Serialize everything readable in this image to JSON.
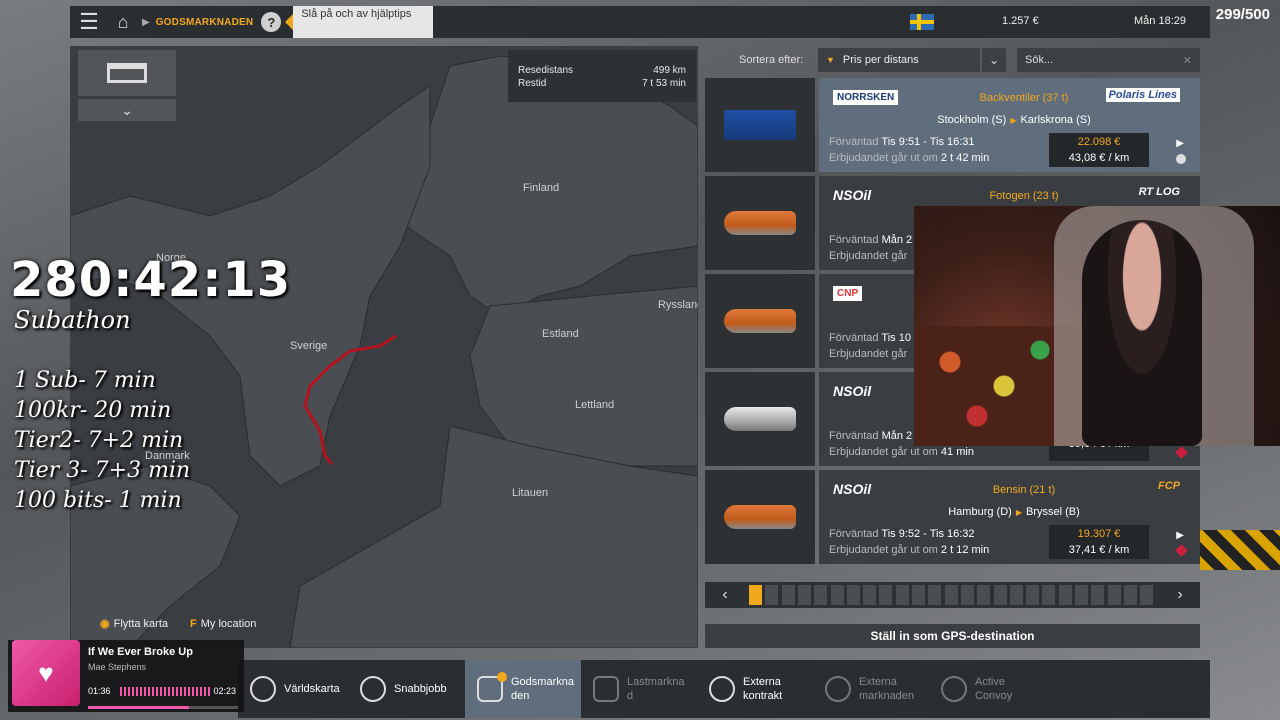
{
  "topbar": {
    "breadcrumb": "GODSMARKNADEN",
    "help": "?",
    "tip": "Slå på och av hjälptips",
    "money": "1.257 €",
    "clock": "Mån 18:29"
  },
  "stream": {
    "counter": "299/500",
    "timer": "280:42:13",
    "subathon": "Subathon",
    "rates": [
      "1 Sub- 7 min",
      "100kr- 20 min",
      "Tier2- 7+2 min",
      "Tier 3- 7+3 min",
      "100 bits- 1 min"
    ]
  },
  "map": {
    "route": {
      "distance_label": "Resedistans",
      "distance": "499 km",
      "time_label": "Restid",
      "time": "7 t 53 min"
    },
    "countries": {
      "finland": "Finland",
      "norge": "Norge",
      "sverige": "Sverige",
      "estland": "Estland",
      "ryssland": "Ryssland",
      "lettland": "Lettland",
      "danmark": "Danmark",
      "litauen": "Litauen"
    },
    "hints": {
      "move_key": "",
      "move_label": "Flytta karta",
      "loc_key": "F",
      "loc_label": "My location"
    }
  },
  "sort": {
    "label": "Sortera efter:",
    "value": "Pris per distans"
  },
  "search": {
    "placeholder": "Sök..."
  },
  "cargo": [
    {
      "sender": "NORRSKEN",
      "cargo": "Backventiler (37 t)",
      "receiver": "Polaris Lines",
      "from": "Stockholm (S)",
      "to": "Karlskrona (S)",
      "expected_label": "Förväntad",
      "expected": "Tis 9:51 - Tis 16:31",
      "expires_label": "Erbjudandet går ut om",
      "expires": "2 t 42 min",
      "price": "22.098 €",
      "per_km": "43,08 € / km"
    },
    {
      "sender": "NSOil",
      "cargo": "Fotogen (23 t)",
      "receiver": "RT LOG",
      "expected_label": "Förväntad",
      "expected": "Mån 2",
      "expires_label": "Erbjudandet går"
    },
    {
      "sender": "CNP",
      "expected_label": "Förväntad",
      "expected": "Tis 10",
      "expires_label": "Erbjudandet går"
    },
    {
      "sender": "NSOil",
      "expected_label": "Förväntad",
      "expected": "Mån 2",
      "expires_label": "Erbjudandet går ut om",
      "expires": "41 min",
      "per_km": "39,04 € / km"
    },
    {
      "sender": "NSOil",
      "cargo": "Bensin (21 t)",
      "receiver": "FCP",
      "from": "Hamburg (D)",
      "to": "Bryssel (B)",
      "expected_label": "Förväntad",
      "expected": "Tis 9:52 - Tis 16:32",
      "expires_label": "Erbjudandet går ut om",
      "expires": "2 t 12 min",
      "price": "19.307 €",
      "per_km": "37,41 € / km"
    }
  ],
  "gps_button": "Ställ in som GPS-destination",
  "nav": {
    "varldskarta": "Världskarta",
    "snabbjobb": "Snabbjobb",
    "godsmarknaden": "Godsmarkna den",
    "lastmarknad": "Lastmarkna d",
    "externa_kontrakt": "Externa kontrakt",
    "externa_marknaden": "Externa marknaden",
    "active_convoy": "Active Convoy"
  },
  "music": {
    "title": "If We Ever Broke Up",
    "artist": "Mae Stephens",
    "current": "01:36",
    "total": "02:23",
    "progress": 0.67
  },
  "colors": {
    "accent": "#f2a81d",
    "route": "#b3121f",
    "selected": "#5f6d7c"
  }
}
